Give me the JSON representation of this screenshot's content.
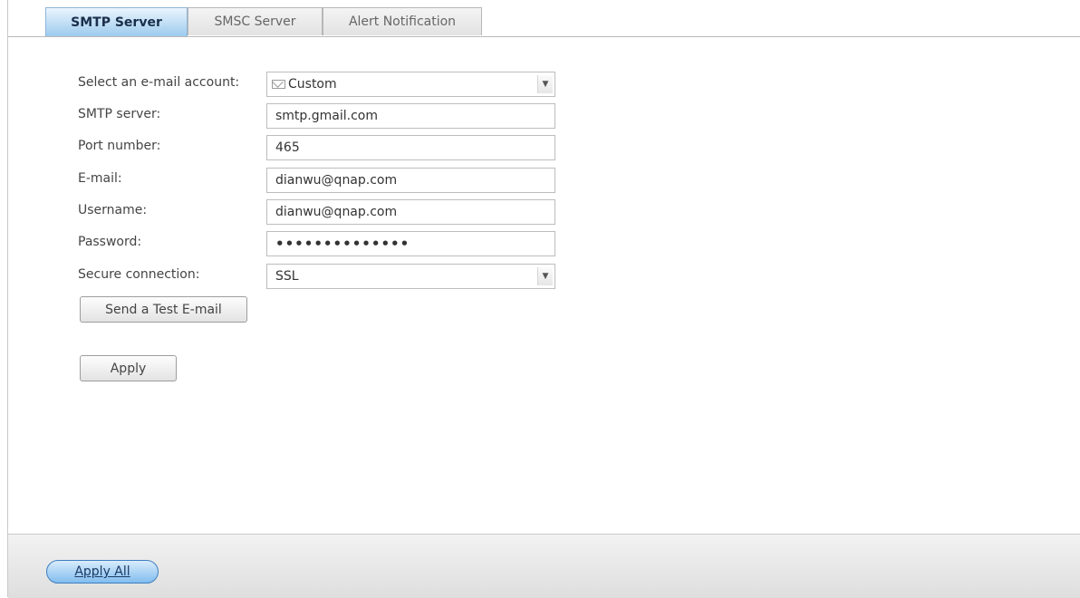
{
  "tabs": [
    {
      "label": "SMTP Server",
      "active": true
    },
    {
      "label": "SMSC Server",
      "active": false
    },
    {
      "label": "Alert Notification",
      "active": false
    }
  ],
  "form": {
    "account": {
      "label": "Select an e-mail account:",
      "value": "Custom",
      "icon": "mail-icon"
    },
    "smtp_server": {
      "label": "SMTP server:",
      "value": "smtp.gmail.com"
    },
    "port": {
      "label": "Port number:",
      "value": "465"
    },
    "email": {
      "label": "E-mail:",
      "value": "dianwu@qnap.com"
    },
    "username": {
      "label": "Username:",
      "value": "dianwu@qnap.com"
    },
    "password": {
      "label": "Password:",
      "value": "••••••••••••••"
    },
    "secure": {
      "label": "Secure connection:",
      "value": "SSL"
    }
  },
  "buttons": {
    "test_email": "Send a Test E-mail",
    "apply": "Apply",
    "apply_all": "Apply All"
  },
  "icons": {
    "dropdown": "chevron-down-icon"
  },
  "colors": {
    "active_tab_top": "#eaf5fd",
    "active_tab_bottom": "#9ccbee",
    "apply_all_accent": "#82bdef"
  }
}
